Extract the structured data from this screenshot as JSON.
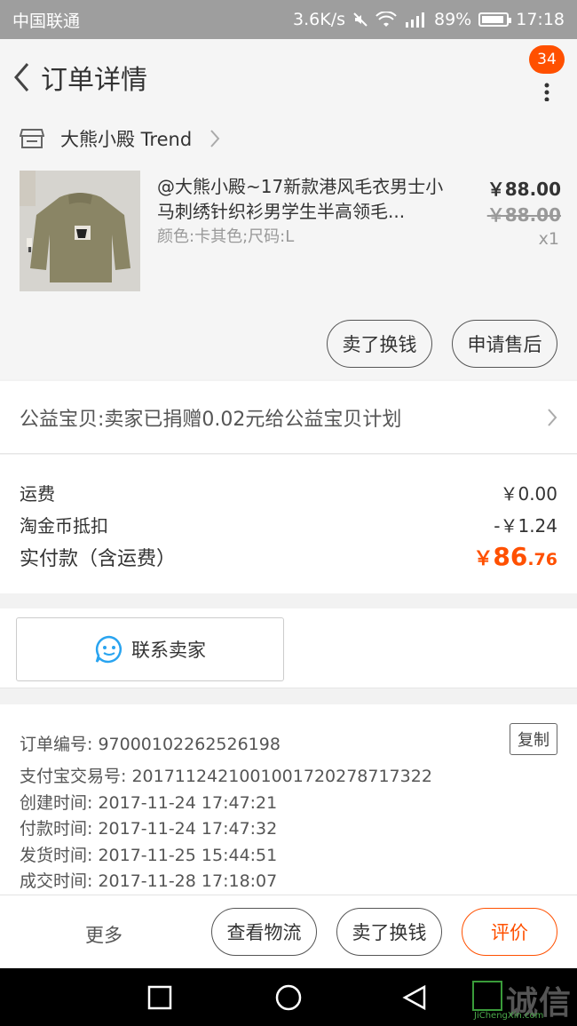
{
  "status_bar": {
    "carrier": "中国联通",
    "speed": "3.6K/s",
    "battery": "89%",
    "time": "17:18"
  },
  "header": {
    "title": "订单详情",
    "badge_count": "34"
  },
  "shop": {
    "name": "大熊小殿 Trend"
  },
  "item": {
    "title": "@大熊小殿~17新款港风毛衣男士小马刺绣针织衫男学生半高领毛...",
    "spec": "颜色:卡其色;尺码:L",
    "price": "￥88.00",
    "original_price": "￥88.00",
    "quantity": "x1",
    "actions": {
      "sell_label": "卖了换钱",
      "after_sale_label": "申请售后"
    }
  },
  "charity": {
    "text": "公益宝贝:卖家已捐赠0.02元给公益宝贝计划"
  },
  "fees": {
    "shipping_label": "运费",
    "shipping_value": "￥0.00",
    "coin_label": "淘金币抵扣",
    "coin_value": "-￥1.24",
    "paid_label": "实付款（含运费）",
    "paid_symbol": "￥",
    "paid_int": "86",
    "paid_dec": ".76"
  },
  "contact": {
    "label": "联系卖家"
  },
  "order_info": {
    "order_no": "订单编号: 97000102262526198",
    "copy_label": "复制",
    "alipay_no": "支付宝交易号: 2017112421001001720278717322",
    "created": "创建时间: 2017-11-24 17:47:21",
    "paid": "付款时间: 2017-11-24 17:47:32",
    "shipped": "发货时间: 2017-11-25 15:44:51",
    "completed": "成交时间: 2017-11-28 17:18:07"
  },
  "bottom_bar": {
    "more_label": "更多",
    "logistics_label": "查看物流",
    "sell_label": "卖了换钱",
    "review_label": "评价"
  },
  "watermark": {
    "text": "诚信",
    "sub": "JiChengXin.com"
  },
  "colors": {
    "accent": "#ff5000",
    "status_bar": "#9e9e9e",
    "background": "#f2f2f2"
  }
}
